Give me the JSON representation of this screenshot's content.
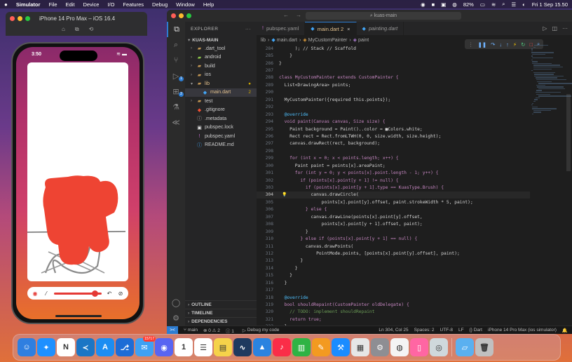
{
  "menubar": {
    "items": [
      "Simulator",
      "File",
      "Edit",
      "Device",
      "I/O",
      "Features",
      "Debug",
      "Window",
      "Help"
    ],
    "battery": "82%",
    "clock": "Fri 1 Sep  15.50"
  },
  "simulator": {
    "title": "iPhone 14 Pro Max – iOS 16.4",
    "status_time": "3:50",
    "stroke_value": 0.85,
    "brush_color": "#e53935"
  },
  "vscode": {
    "nav_back": "←",
    "nav_forward": "→",
    "search": "kuas-main",
    "explorer": {
      "header": "EXPLORER",
      "root": "KUAS-MAIN",
      "items": [
        {
          "label": ".dart_tool",
          "type": "folder",
          "icon": "folder-icon",
          "depth": 1
        },
        {
          "label": "android",
          "type": "folder",
          "icon": "android-icon",
          "depth": 1
        },
        {
          "label": "build",
          "type": "folder",
          "icon": "folder-icon",
          "depth": 1
        },
        {
          "label": "ios",
          "type": "folder",
          "icon": "folder-icon",
          "depth": 1
        },
        {
          "label": "lib",
          "type": "folder-open",
          "icon": "folder-icon",
          "depth": 1,
          "badge": "●"
        },
        {
          "label": "main.dart",
          "type": "file",
          "icon": "dart-icon",
          "depth": 2,
          "badge": "2",
          "selected": true
        },
        {
          "label": "test",
          "type": "folder",
          "icon": "folder-icon",
          "depth": 1
        },
        {
          "label": ".gitignore",
          "type": "file",
          "icon": "git-icon",
          "depth": 1
        },
        {
          "label": ".metadata",
          "type": "file",
          "icon": "info-icon",
          "depth": 1
        },
        {
          "label": "pubspec.lock",
          "type": "file",
          "icon": "lock-icon",
          "depth": 1
        },
        {
          "label": "pubspec.yaml",
          "type": "file",
          "icon": "yaml-icon",
          "depth": 1
        },
        {
          "label": "README.md",
          "type": "file",
          "icon": "markdown-icon",
          "depth": 1
        }
      ],
      "sections": [
        "OUTLINE",
        "TIMELINE",
        "DEPENDENCIES"
      ]
    },
    "tabs": [
      {
        "label": "pubspec.yaml",
        "active": false
      },
      {
        "label": "main.dart 2",
        "active": true
      },
      {
        "label": "painting.dart",
        "active": false,
        "italic": true
      }
    ],
    "breadcrumb": [
      "lib",
      "main.dart",
      "MyCustomPainter",
      "paint"
    ],
    "code": [
      {
        "n": "284",
        "t": "      ); // Stack // Scaffold"
      },
      {
        "n": "285",
        "t": "    }"
      },
      {
        "n": "286",
        "t": "}"
      },
      {
        "n": "287",
        "t": ""
      },
      {
        "n": "288",
        "t": "class MyCustomPainter extends CustomPainter {"
      },
      {
        "n": "289",
        "t": "  List<DrawingArea> points;"
      },
      {
        "n": "290",
        "t": ""
      },
      {
        "n": "291",
        "t": "  MyCustomPainter({required this.points});"
      },
      {
        "n": "292",
        "t": ""
      },
      {
        "n": "293",
        "t": "  @override"
      },
      {
        "n": "294",
        "t": "  void paint(Canvas canvas, Size size) {"
      },
      {
        "n": "295",
        "t": "    Paint background = Paint()..color = ■Colors.white;"
      },
      {
        "n": "296",
        "t": "    Rect rect = Rect.fromLTWH(0, 0, size.width, size.height);"
      },
      {
        "n": "297",
        "t": "    canvas.drawRect(rect, background);"
      },
      {
        "n": "298",
        "t": ""
      },
      {
        "n": "299",
        "t": "    for (int x = 0; x < points.length; x++) {"
      },
      {
        "n": "300",
        "t": "      Paint paint = points[x].areaPaint;"
      },
      {
        "n": "301",
        "t": "      for (int y = 0; y < points[x].point.length - 1; y++) {"
      },
      {
        "n": "302",
        "t": "        if (points[x].point[y + 1] != null) {"
      },
      {
        "n": "303",
        "t": "          if (points[x].point[y + 1].type == KuasType.Brush) {"
      },
      {
        "n": "304",
        "t": "            canvas.drawCircle("
      },
      {
        "n": "305",
        "t": "                points[x].point[y].offset, paint.strokeWidth * 5, paint);"
      },
      {
        "n": "306",
        "t": "          } else {"
      },
      {
        "n": "307",
        "t": "            canvas.drawLine(points[x].point[y].offset,"
      },
      {
        "n": "308",
        "t": "                points[x].point[y + 1].offset, paint);"
      },
      {
        "n": "309",
        "t": "          }"
      },
      {
        "n": "310",
        "t": "        } else if (points[x].point[y + 1] == null) {"
      },
      {
        "n": "311",
        "t": "          canvas.drawPoints("
      },
      {
        "n": "312",
        "t": "              PointMode.points, [points[x].point[y].offset], paint);"
      },
      {
        "n": "313",
        "t": "        }"
      },
      {
        "n": "314",
        "t": "      }"
      },
      {
        "n": "315",
        "t": "    }"
      },
      {
        "n": "316",
        "t": "  }"
      },
      {
        "n": "317",
        "t": ""
      },
      {
        "n": "318",
        "t": "  @override"
      },
      {
        "n": "319",
        "t": "  bool shouldRepaint(CustomPainter oldDelegate) {"
      },
      {
        "n": "320",
        "t": "    // TODO: implement shouldRepaint"
      },
      {
        "n": "321",
        "t": "    return true;"
      },
      {
        "n": "322",
        "t": "  }"
      }
    ],
    "current_line": "304",
    "statusbar": {
      "remote": "><",
      "branch": "main",
      "problems": "⊗ 0 ⚠ 2",
      "problems_extra": "ⓘ 1",
      "debug": "Debug my code",
      "position": "Ln 304, Col 25",
      "spaces": "Spaces: 2",
      "encoding": "UTF-8",
      "eol": "LF",
      "language": "{} Dart",
      "device": "iPhone 14 Pro Max (ios simulator)"
    }
  },
  "dock": {
    "apps": [
      {
        "name": "finder-icon",
        "color": "#2f7fe0",
        "glyph": "☺"
      },
      {
        "name": "safari-icon",
        "color": "#1e90ff",
        "glyph": "✦"
      },
      {
        "name": "notion-icon",
        "color": "#ffffff",
        "glyph": "N"
      },
      {
        "name": "vscode-icon",
        "color": "#1b76c5",
        "glyph": "≺"
      },
      {
        "name": "app-store-icon",
        "color": "#1c8df2",
        "glyph": "A"
      },
      {
        "name": "sourcetree-icon",
        "color": "#1d6cd6",
        "glyph": "⎇"
      },
      {
        "name": "mail-icon",
        "color": "#3ea1f4",
        "glyph": "✉",
        "badge": "15717"
      },
      {
        "name": "discord-icon",
        "color": "#5865f2",
        "glyph": "◉"
      },
      {
        "name": "calendar-icon",
        "color": "#ffffff",
        "glyph": "1"
      },
      {
        "name": "reminders-icon",
        "color": "#ffffff",
        "glyph": "☰"
      },
      {
        "name": "notes-icon",
        "color": "#f5d24a",
        "glyph": "▤"
      },
      {
        "name": "stocks-icon",
        "color": "#1e3a5f",
        "glyph": "∿"
      },
      {
        "name": "keynote-icon",
        "color": "#2a83e0",
        "glyph": "▲"
      },
      {
        "name": "music-icon",
        "color": "#fa2d48",
        "glyph": "♪"
      },
      {
        "name": "numbers-icon",
        "color": "#2fb344",
        "glyph": "▥"
      },
      {
        "name": "pages-icon",
        "color": "#f39a20",
        "glyph": "✎"
      },
      {
        "name": "xcode-icon",
        "color": "#1a8cff",
        "glyph": "⚒"
      },
      {
        "name": "launchpad-icon",
        "color": "#e6e6e6",
        "glyph": "▦"
      },
      {
        "name": "system-settings-icon",
        "color": "#8e8e93",
        "glyph": "⚙"
      },
      {
        "name": "chrome-icon",
        "color": "#f4f4f4",
        "glyph": "◍"
      },
      {
        "name": "simulator-icon",
        "color": "#ff66a3",
        "glyph": "▯"
      },
      {
        "name": "disk-utility-icon",
        "color": "#cfd8dc",
        "glyph": "◎"
      }
    ],
    "trailing": [
      {
        "name": "downloads-folder-icon",
        "color": "#5ab0f0",
        "glyph": "▱"
      },
      {
        "name": "trash-icon",
        "color": "#c0c0c0",
        "glyph": "🗑"
      }
    ]
  }
}
